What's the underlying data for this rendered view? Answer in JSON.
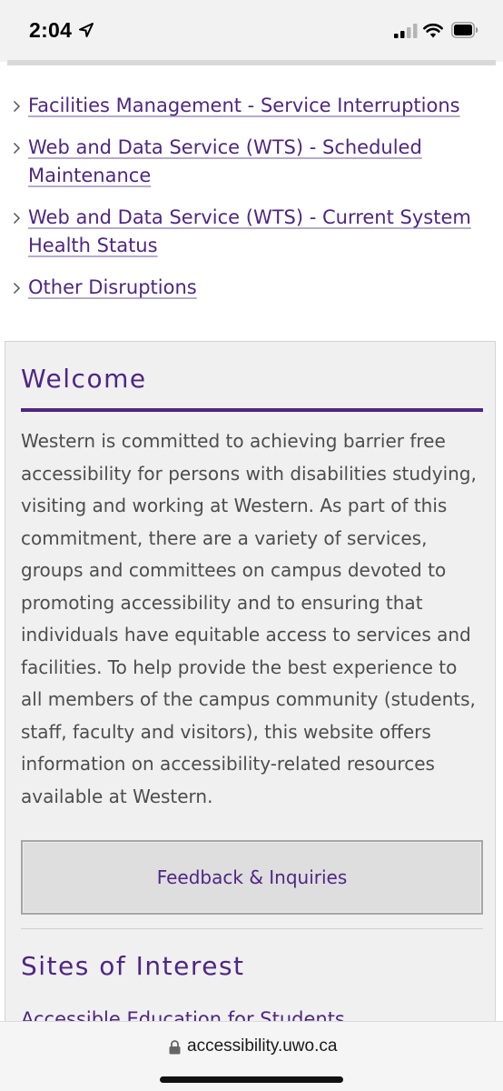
{
  "status_bar": {
    "time": "2:04",
    "icons": [
      "location-arrow-icon",
      "cellular-signal-icon",
      "wifi-icon",
      "battery-icon"
    ]
  },
  "links": [
    {
      "label": "Facilities Management - Service Interruptions"
    },
    {
      "label": "Web and Data Service (WTS) - Scheduled Maintenance"
    },
    {
      "label": "Web and Data Service (WTS) - Current System Health Status"
    },
    {
      "label": "Other Disruptions"
    }
  ],
  "welcome": {
    "title": "Welcome",
    "body": "Western is committed to achieving barrier free accessibility for persons with disabilities studying, visiting and working at Western. As part of this commitment, there are a variety of services, groups and committees on campus devoted to promoting accessibility and to ensuring that individuals have equitable access to services and facilities. To help provide the best experience to all members of the campus community (students, staff, faculty and visitors), this website offers information on accessibility-related resources available at Western.",
    "button_label": "Feedback & Inquiries"
  },
  "sites": {
    "title": "Sites of Interest",
    "first_link": "Accessible Education for Students"
  },
  "browser": {
    "url": "accessibility.uwo.ca"
  },
  "colors": {
    "accent_purple": "#4f2683",
    "text_gray": "#4d4d4d",
    "panel_gray": "#f0f0f0"
  }
}
